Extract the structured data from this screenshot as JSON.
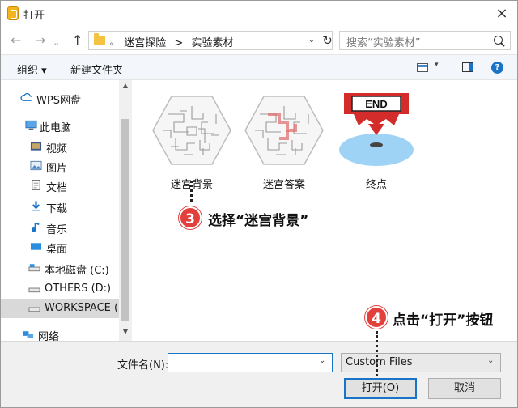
{
  "window": {
    "title": "打开",
    "close_icon": "×"
  },
  "nav": {
    "back": "←",
    "forward": "→",
    "up": "↑",
    "path_prefix": "«",
    "path": [
      "迷宫探险",
      "实验素材"
    ],
    "path_sep": ">",
    "refresh": "↻",
    "search_placeholder": "搜索“实验素材”"
  },
  "toolbar": {
    "organize": "组织 ▾",
    "new_folder": "新建文件夹",
    "help": "?"
  },
  "sidebar": {
    "items": [
      {
        "label": "WPS网盘",
        "icon": "cloud-icon"
      },
      {
        "label": "此电脑",
        "icon": "computer-icon"
      },
      {
        "label": "视频",
        "icon": "video-icon"
      },
      {
        "label": "图片",
        "icon": "picture-icon"
      },
      {
        "label": "文档",
        "icon": "document-icon"
      },
      {
        "label": "下载",
        "icon": "download-icon"
      },
      {
        "label": "音乐",
        "icon": "music-icon"
      },
      {
        "label": "桌面",
        "icon": "desktop-icon"
      },
      {
        "label": "本地磁盘 (C:)",
        "icon": "drive-icon"
      },
      {
        "label": "OTHERS (D:)",
        "icon": "drive-icon"
      },
      {
        "label": "WORKSPACE (E",
        "icon": "drive-icon"
      },
      {
        "label": "网络",
        "icon": "network-icon"
      }
    ]
  },
  "files": [
    {
      "name": "迷宫背景",
      "icon": "maze-icon"
    },
    {
      "name": "迷宫答案",
      "icon": "maze-solution-icon"
    },
    {
      "name": "终点",
      "icon": "end-point-icon",
      "badge": "END"
    }
  ],
  "bottom": {
    "filename_label": "文件名(N):",
    "filename_value": "",
    "filetype": "Custom Files",
    "open": "打开(O)",
    "cancel": "取消"
  },
  "annotations": [
    {
      "number": "3",
      "text": "选择“迷宫背景”"
    },
    {
      "number": "4",
      "text": "点击“打开”按钮"
    }
  ],
  "colors": {
    "accent": "#1a73c7",
    "marker": "#e2403c",
    "end_red": "#d42b2b",
    "disc_blue": "#9fd3f5"
  }
}
